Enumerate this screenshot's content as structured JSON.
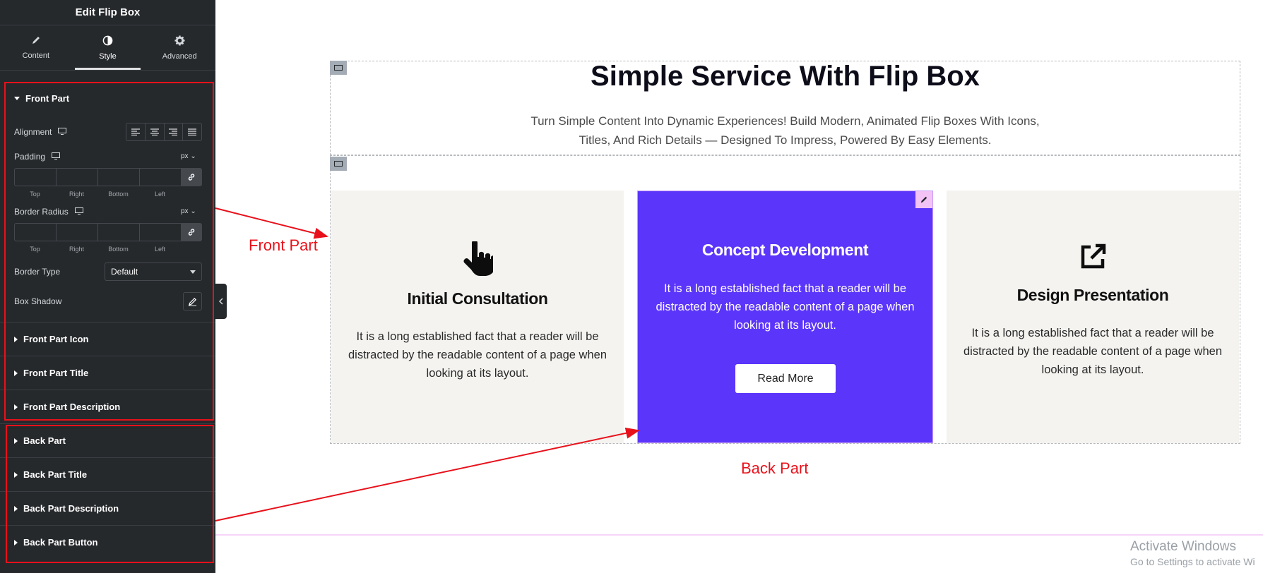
{
  "panel": {
    "title": "Edit Flip Box",
    "tabs": [
      {
        "label": "Content",
        "icon": "pencil-icon"
      },
      {
        "label": "Style",
        "icon": "contrast-icon"
      },
      {
        "label": "Advanced",
        "icon": "gear-icon"
      }
    ],
    "active_tab": "Style",
    "front_part": {
      "title": "Front Part",
      "alignment_label": "Alignment",
      "padding_label": "Padding",
      "padding_unit": "px",
      "border_radius_label": "Border Radius",
      "border_radius_unit": "px",
      "dim_labels": [
        "Top",
        "Right",
        "Bottom",
        "Left"
      ],
      "border_type_label": "Border Type",
      "border_type_value": "Default",
      "box_shadow_label": "Box Shadow"
    },
    "sections": [
      "Front Part Icon",
      "Front Part Title",
      "Front Part Description",
      "Back Part",
      "Back Part Title",
      "Back Part Description",
      "Back Part Button"
    ]
  },
  "canvas": {
    "heading": "Simple Service With Flip Box",
    "subtext_line1": "Turn Simple Content Into Dynamic Experiences! Build Modern, Animated Flip Boxes With Icons,",
    "subtext_line2": "Titles, And Rich Details — Designed To Impress, Powered By Easy Elements.",
    "cards": [
      {
        "title": "Initial Consultation",
        "icon": "hand-pointer-icon",
        "desc": "It is a long established fact that a reader will be distracted by the readable content of a page when looking at its layout."
      },
      {
        "title": "Concept Development",
        "desc": "It is a long established fact that a reader will be distracted by the readable content of a page when looking at its layout.",
        "button": "Read More"
      },
      {
        "title": "Design Presentation",
        "icon": "external-link-icon",
        "desc": "It is a long established fact that a reader will be distracted by the readable content of a page when looking at its layout."
      }
    ]
  },
  "annotations": {
    "front": "Front Part",
    "back": "Back Part"
  },
  "watermark": {
    "title": "Activate Windows",
    "subtitle": "Go to Settings to activate Wi"
  },
  "colors": {
    "panel_bg": "#26292c",
    "back_card": "#5b35fa",
    "front_card": "#f4f3f0",
    "annotation_red": "#e8111b"
  }
}
